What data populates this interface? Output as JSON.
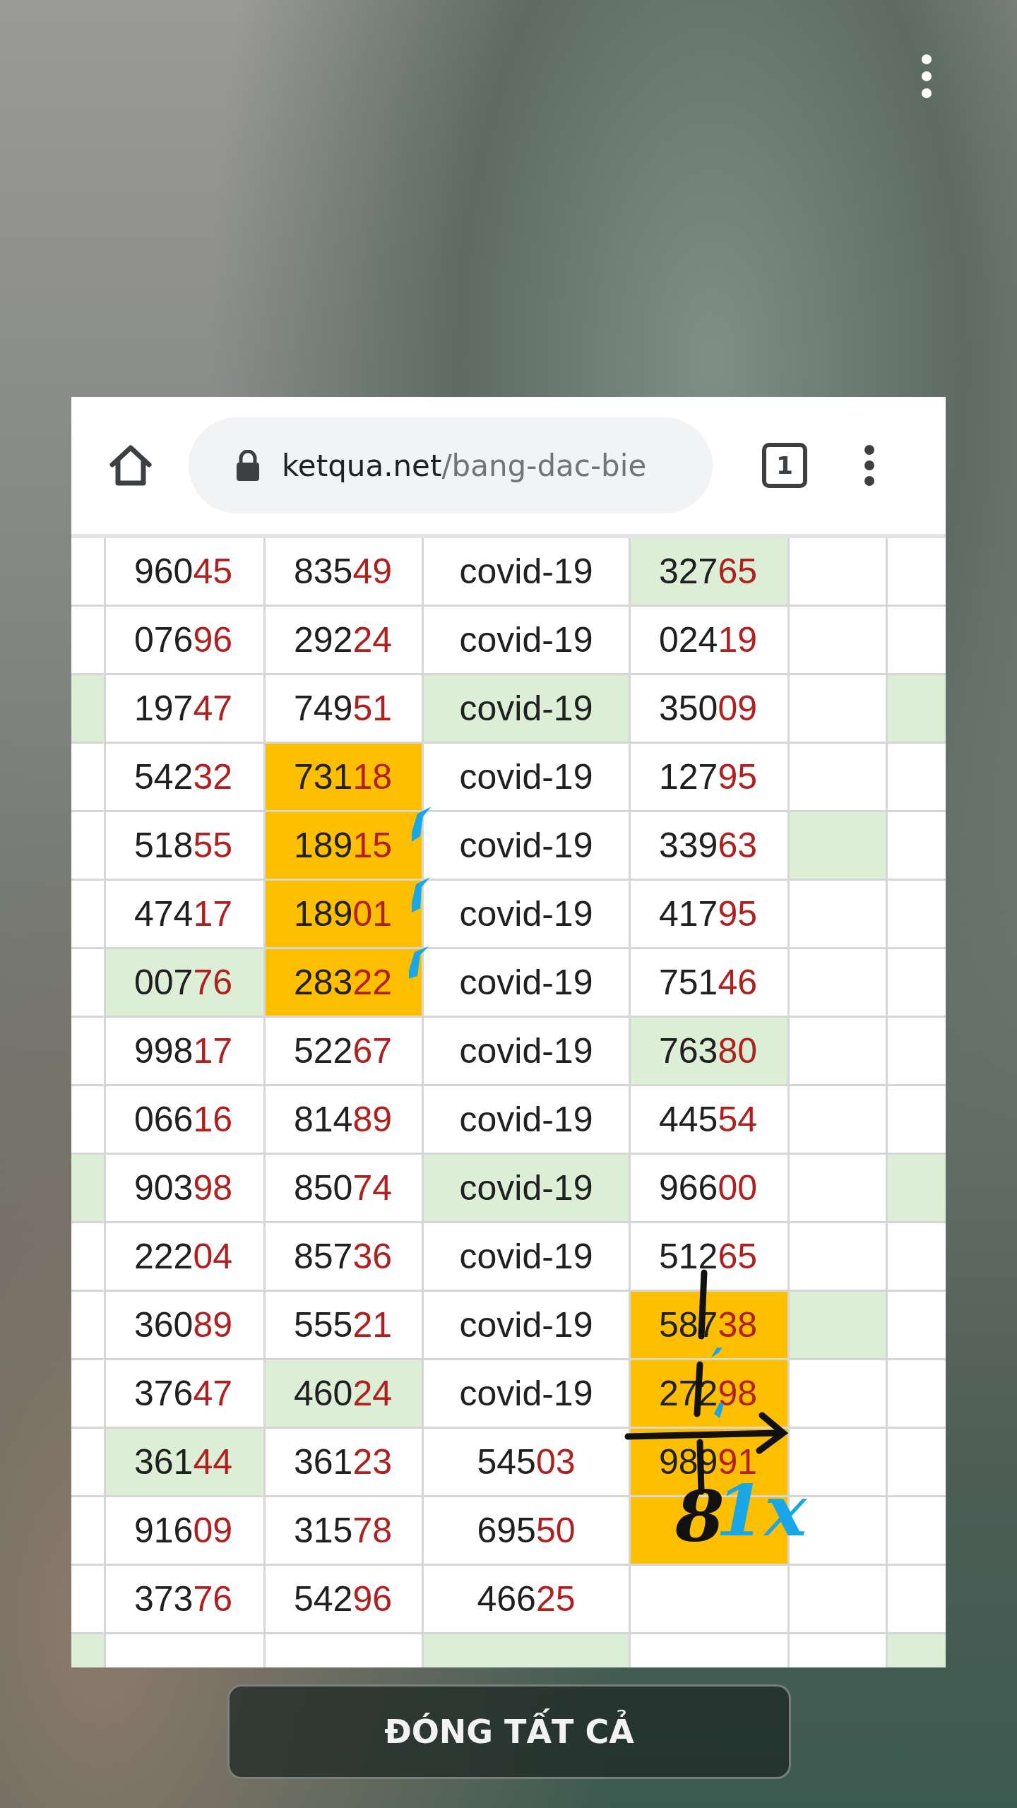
{
  "browser": {
    "url_host": "ketqua.net",
    "url_path": "/bang-dac-bie",
    "tab_count": "1"
  },
  "table": {
    "rows": [
      {
        "cells": [
          {},
          {
            "prefix": "960",
            "suffix": "45"
          },
          {
            "prefix": "835",
            "suffix": "49"
          },
          {
            "text": "covid-19"
          },
          {
            "color": "#dcefd6",
            "prefix": "327",
            "suffix": "65"
          },
          {},
          {}
        ]
      },
      {
        "cells": [
          {},
          {
            "prefix": "076",
            "suffix": "96"
          },
          {
            "prefix": "292",
            "suffix": "24"
          },
          {
            "text": "covid-19"
          },
          {
            "prefix": "024",
            "suffix": "19"
          },
          {},
          {}
        ]
      },
      {
        "cells": [
          {
            "color": "#dcefd6"
          },
          {
            "prefix": "197",
            "suffix": "47"
          },
          {
            "prefix": "749",
            "suffix": "51"
          },
          {
            "color": "#dcefd6",
            "text": "covid-19"
          },
          {
            "prefix": "350",
            "suffix": "09"
          },
          {},
          {
            "color": "#dcefd6"
          }
        ]
      },
      {
        "cells": [
          {},
          {
            "prefix": "542",
            "suffix": "32"
          },
          {
            "color": "#fdbf00",
            "prefix": "731",
            "suffix": "18"
          },
          {
            "text": "covid-19"
          },
          {
            "prefix": "127",
            "suffix": "95"
          },
          {},
          {}
        ]
      },
      {
        "cells": [
          {},
          {
            "prefix": "518",
            "suffix": "55"
          },
          {
            "color": "#fdbf00",
            "prefix": "189",
            "suffix": "15"
          },
          {
            "text": "covid-19"
          },
          {
            "prefix": "339",
            "suffix": "63"
          },
          {
            "color": "#dcefd6"
          },
          {}
        ]
      },
      {
        "cells": [
          {},
          {
            "prefix": "474",
            "suffix": "17"
          },
          {
            "color": "#fdbf00",
            "prefix": "189",
            "suffix": "01"
          },
          {
            "text": "covid-19"
          },
          {
            "prefix": "417",
            "suffix": "95"
          },
          {},
          {}
        ]
      },
      {
        "cells": [
          {},
          {
            "color": "#dcefd6",
            "prefix": "007",
            "suffix": "76"
          },
          {
            "color": "#fdbf00",
            "prefix": "283",
            "suffix": "22"
          },
          {
            "text": "covid-19"
          },
          {
            "prefix": "751",
            "suffix": "46"
          },
          {},
          {}
        ]
      },
      {
        "cells": [
          {},
          {
            "prefix": "998",
            "suffix": "17"
          },
          {
            "prefix": "522",
            "suffix": "67"
          },
          {
            "text": "covid-19"
          },
          {
            "color": "#dcefd6",
            "prefix": "763",
            "suffix": "80"
          },
          {},
          {}
        ]
      },
      {
        "cells": [
          {},
          {
            "prefix": "066",
            "suffix": "16"
          },
          {
            "prefix": "814",
            "suffix": "89"
          },
          {
            "text": "covid-19"
          },
          {
            "prefix": "445",
            "suffix": "54"
          },
          {},
          {}
        ]
      },
      {
        "cells": [
          {
            "color": "#dcefd6"
          },
          {
            "prefix": "903",
            "suffix": "98"
          },
          {
            "prefix": "850",
            "suffix": "74"
          },
          {
            "color": "#dcefd6",
            "text": "covid-19"
          },
          {
            "prefix": "966",
            "suffix": "00"
          },
          {},
          {
            "color": "#dcefd6"
          }
        ]
      },
      {
        "cells": [
          {},
          {
            "prefix": "222",
            "suffix": "04"
          },
          {
            "prefix": "857",
            "suffix": "36"
          },
          {
            "text": "covid-19"
          },
          {
            "prefix": "512",
            "suffix": "65"
          },
          {},
          {}
        ]
      },
      {
        "cells": [
          {},
          {
            "prefix": "360",
            "suffix": "89"
          },
          {
            "prefix": "555",
            "suffix": "21"
          },
          {
            "text": "covid-19"
          },
          {
            "color": "#fdbf00",
            "prefix": "587",
            "suffix": "38"
          },
          {
            "color": "#dcefd6"
          },
          {}
        ]
      },
      {
        "cells": [
          {},
          {
            "prefix": "376",
            "suffix": "47"
          },
          {
            "color": "#dcefd6",
            "prefix": "460",
            "suffix": "24"
          },
          {
            "text": "covid-19"
          },
          {
            "color": "#fdbf00",
            "prefix": "272",
            "suffix": "98"
          },
          {},
          {}
        ]
      },
      {
        "cells": [
          {},
          {
            "color": "#dcefd6",
            "prefix": "361",
            "suffix": "44"
          },
          {
            "prefix": "361",
            "suffix": "23"
          },
          {
            "prefix": "545",
            "suffix": "03"
          },
          {
            "color": "#fdbf00",
            "prefix": "989",
            "suffix": "91"
          },
          {},
          {}
        ]
      },
      {
        "cells": [
          {},
          {
            "prefix": "916",
            "suffix": "09"
          },
          {
            "prefix": "315",
            "suffix": "78"
          },
          {
            "prefix": "695",
            "suffix": "50"
          },
          {
            "color": "#fdbf00"
          },
          {},
          {}
        ]
      },
      {
        "cells": [
          {},
          {
            "prefix": "373",
            "suffix": "76"
          },
          {
            "prefix": "542",
            "suffix": "96"
          },
          {
            "prefix": "466",
            "suffix": "25"
          },
          {},
          {},
          {}
        ]
      },
      {
        "cells": [
          {
            "color": "#dcefd6"
          },
          {},
          {},
          {
            "color": "#dcefd6"
          },
          {},
          {},
          {
            "color": "#dcefd6"
          }
        ]
      }
    ]
  },
  "annotations": [
    {
      "text": "8",
      "color": "#111111"
    },
    {
      "text": "1x",
      "color": "#1aa7e8"
    }
  ],
  "close_all_button": "ĐÓNG TẤT CẢ"
}
